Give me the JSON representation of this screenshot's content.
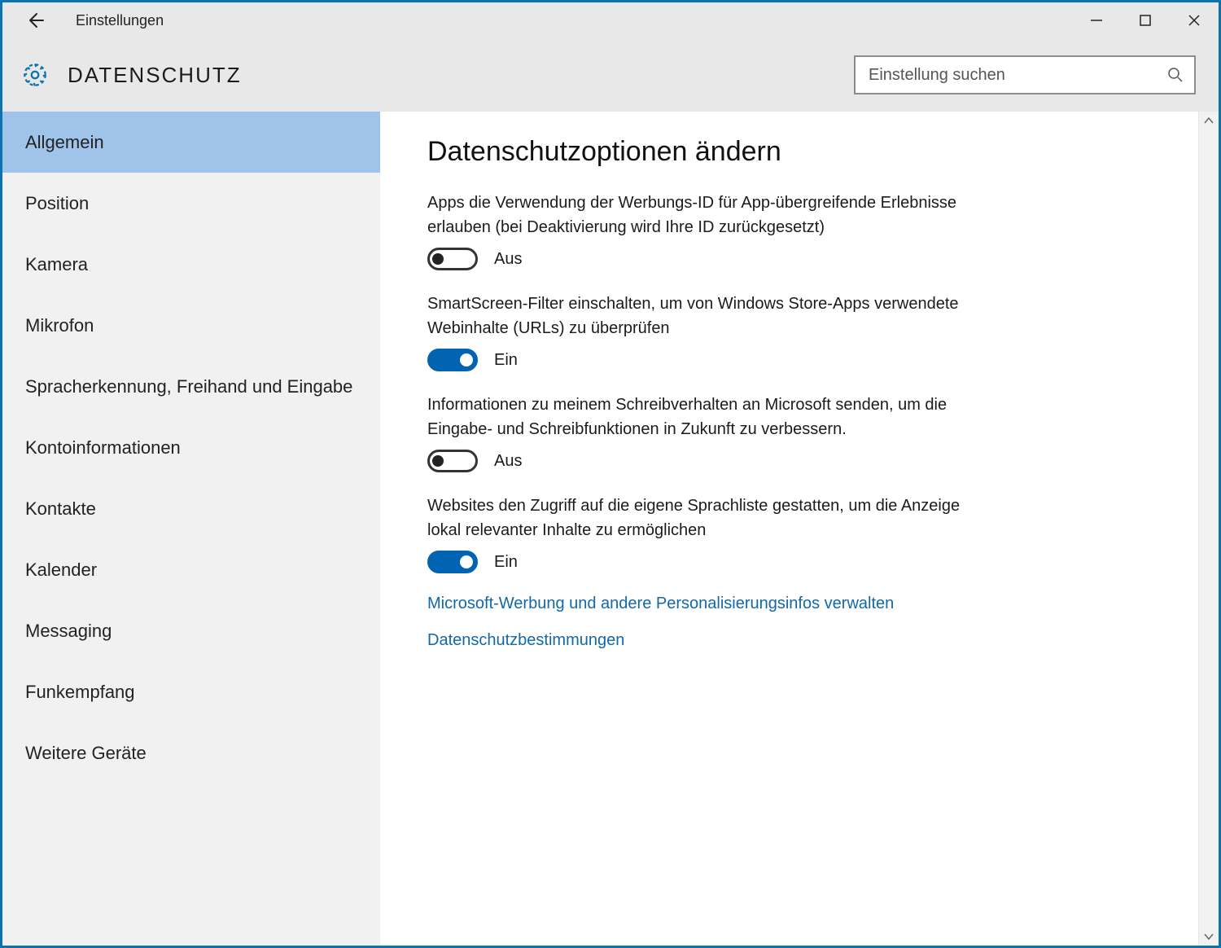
{
  "titlebar": {
    "title": "Einstellungen"
  },
  "header": {
    "page_title": "DATENSCHUTZ"
  },
  "search": {
    "placeholder": "Einstellung suchen"
  },
  "sidebar": {
    "selected_index": 0,
    "items": [
      {
        "label": "Allgemein"
      },
      {
        "label": "Position"
      },
      {
        "label": "Kamera"
      },
      {
        "label": "Mikrofon"
      },
      {
        "label": "Spracherkennung, Freihand und Eingabe"
      },
      {
        "label": "Kontoinformationen"
      },
      {
        "label": "Kontakte"
      },
      {
        "label": "Kalender"
      },
      {
        "label": "Messaging"
      },
      {
        "label": "Funkempfang"
      },
      {
        "label": "Weitere Geräte"
      }
    ]
  },
  "content": {
    "heading": "Datenschutzoptionen ändern",
    "state_on": "Ein",
    "state_off": "Aus",
    "settings": [
      {
        "desc": "Apps die Verwendung der Werbungs-ID für App-übergreifende Erlebnisse erlauben (bei Deaktivierung wird Ihre ID zurückgesetzt)",
        "on": false
      },
      {
        "desc": "SmartScreen-Filter einschalten, um von Windows Store-Apps verwendete Webinhalte (URLs) zu überprüfen",
        "on": true
      },
      {
        "desc": "Informationen zu meinem Schreibverhalten an Microsoft senden, um die Eingabe- und Schreibfunktionen in Zukunft zu verbessern.",
        "on": false
      },
      {
        "desc": "Websites den Zugriff auf die eigene Sprachliste gestatten, um die Anzeige lokal relevanter Inhalte zu ermöglichen",
        "on": true
      }
    ],
    "links": [
      {
        "label": "Microsoft-Werbung und andere Personalisierungsinfos verwalten"
      },
      {
        "label": "Datenschutzbestimmungen"
      }
    ]
  }
}
